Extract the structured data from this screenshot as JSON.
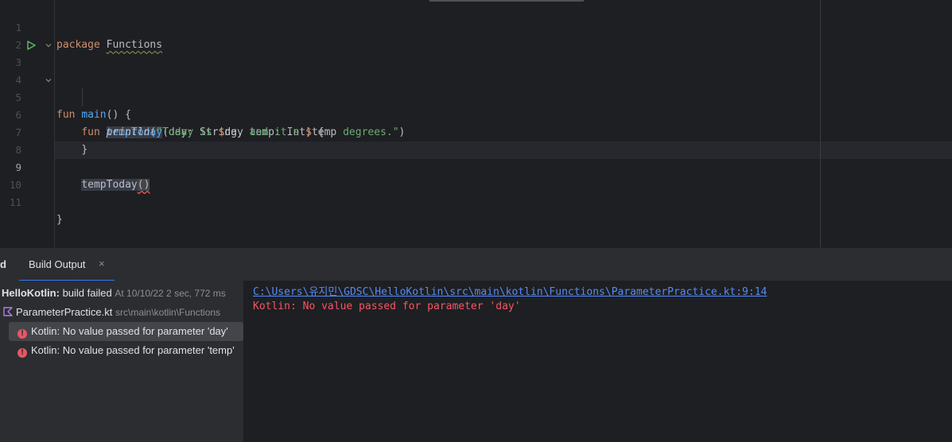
{
  "editor": {
    "line_numbers": [
      "1",
      "2",
      "3",
      "4",
      "5",
      "6",
      "7",
      "8",
      "9",
      "10",
      "11"
    ],
    "line1": {
      "kw": "package",
      "name": "Functions"
    },
    "line3": {
      "kw": "fun",
      "name": "main",
      "rest": "() {"
    },
    "line5": {
      "kw": "fun",
      "name": "tempToday",
      "rest": "(day: String, temp: Int) {"
    },
    "line6": {
      "fn": "println",
      "p1": "(",
      "s1": "\"Today is ",
      "t1": "$",
      "v1": "day",
      "s2": " and it's ",
      "t2": "$",
      "v2": "temp",
      "s3": " degrees.\"",
      "p2": ")"
    },
    "line7": "}",
    "line9": {
      "name": "tempToday",
      "parens": "()"
    },
    "line11": "}",
    "colors": {
      "keyword": "#cf8e6d",
      "function": "#56a8f5",
      "string": "#6aab73",
      "error": "#f75464"
    }
  },
  "tool_window": {
    "title": "d",
    "tabs": [
      {
        "label": "Build Output",
        "close": "×"
      }
    ]
  },
  "build_tree": {
    "root": {
      "project": "HelloKotlin:",
      "status": "build failed",
      "meta": "At 10/10/22 2 sec, 772 ms"
    },
    "file": {
      "name": "ParameterPractice.kt",
      "path": "src\\main\\kotlin\\Functions"
    },
    "errors": [
      {
        "text": "Kotlin: No value passed for parameter 'day'"
      },
      {
        "text": "Kotlin: No value passed for parameter 'temp'"
      }
    ]
  },
  "output": {
    "link": "C:\\Users\\유지민\\GDSC\\HelloKotlin\\src\\main\\kotlin\\Functions\\ParameterPractice.kt:9:14",
    "error": "Kotlin: No value passed for parameter 'day'"
  }
}
